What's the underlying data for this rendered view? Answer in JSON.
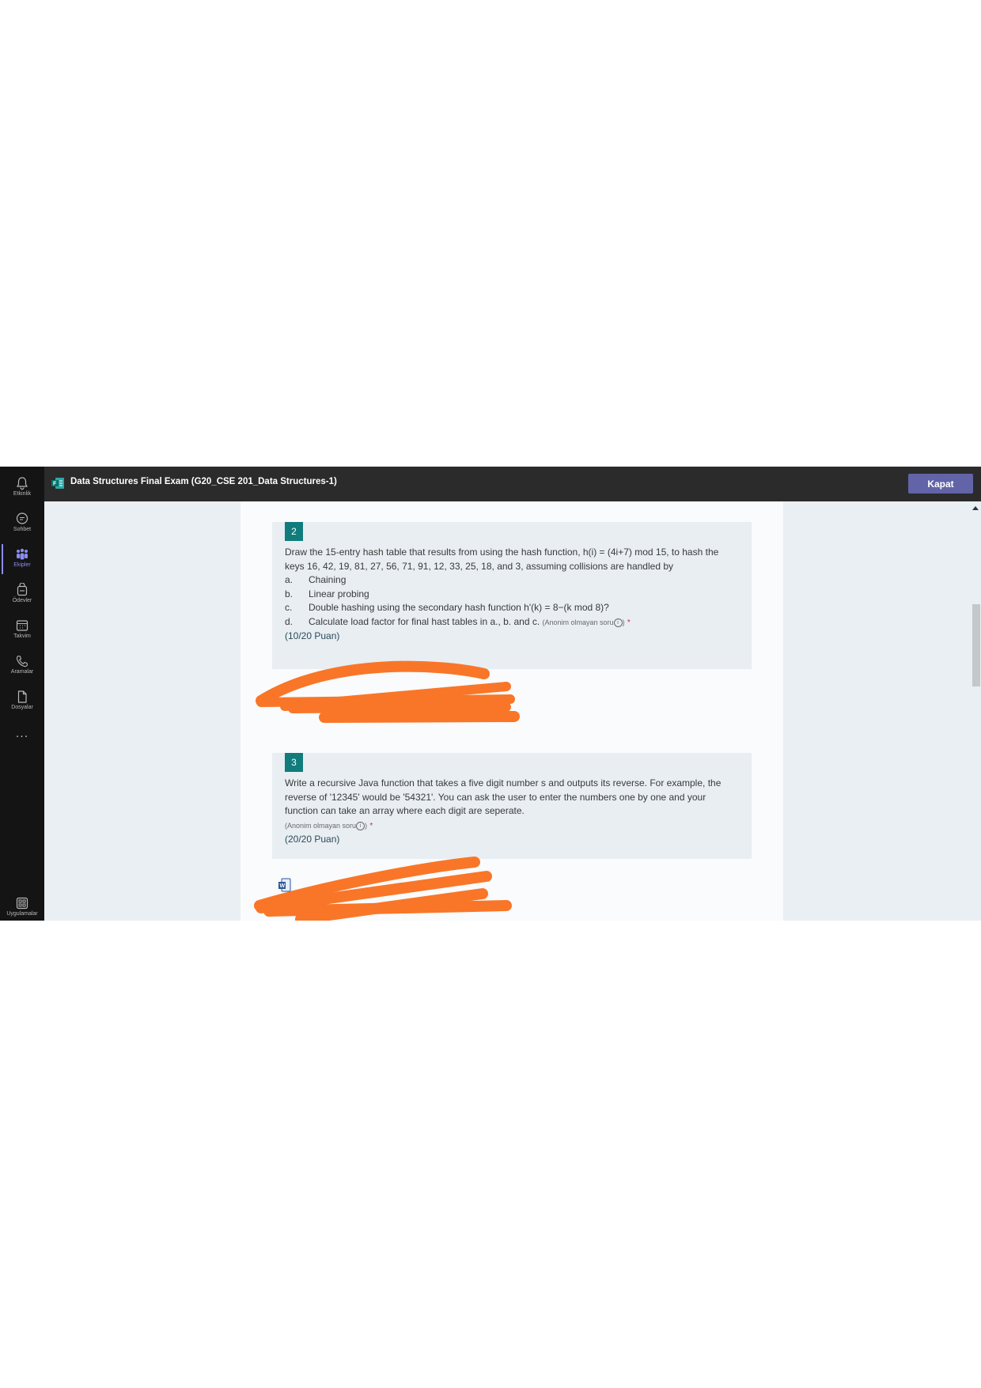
{
  "rail": {
    "items": [
      {
        "label": "Etkinlik",
        "icon": "bell-icon"
      },
      {
        "label": "Sohbet",
        "icon": "chat-icon"
      },
      {
        "label": "Ekipler",
        "icon": "teams-icon"
      },
      {
        "label": "Ödevler",
        "icon": "assignments-icon"
      },
      {
        "label": "Takvim",
        "icon": "calendar-icon"
      },
      {
        "label": "Aramalar",
        "icon": "phone-icon"
      },
      {
        "label": "Dosyalar",
        "icon": "file-icon"
      }
    ],
    "more": "...",
    "apps_label": "Uygulamalar"
  },
  "titlebar": {
    "title": "Data Structures Final Exam (G20_CSE 201_Data Structures-1)",
    "close_label": "Kapat"
  },
  "questions": [
    {
      "number": "2",
      "intro": "Draw the 15-entry hash table that results from using the hash function, h(i) = (4i+7) mod 15, to hash the keys 16, 42, 19, 81, 27, 56, 71, 91, 12, 33, 25, 18, and 3, assuming collisions are handled by",
      "options": [
        {
          "letter": "a.",
          "text": "Chaining"
        },
        {
          "letter": "b.",
          "text": "Linear probing"
        },
        {
          "letter": "c.",
          "text": "Double hashing using the secondary hash function h'(k) = 8−(k mod 8)?"
        },
        {
          "letter": "d.",
          "text": "Calculate load factor for final hast tables in a., b. and c."
        }
      ],
      "anon_note": "(Anonim olmayan soru",
      "anon_close": ")",
      "required": "*",
      "points": "(10/20 Puan)"
    },
    {
      "number": "3",
      "intro": "Write a recursive Java function that takes a five digit number s and outputs its reverse. For example, the reverse of '12345' would be '54321'. You can ask the user to enter the numbers one by one and your function can take an array where each digit are seperate.",
      "anon_note": "(Anonim olmayan soru",
      "anon_close": ")",
      "required": "*",
      "points": "(20/20 Puan)"
    }
  ],
  "colors": {
    "accent": "#6264a7",
    "question_badge": "#107c7c",
    "redaction": "#f97628"
  }
}
